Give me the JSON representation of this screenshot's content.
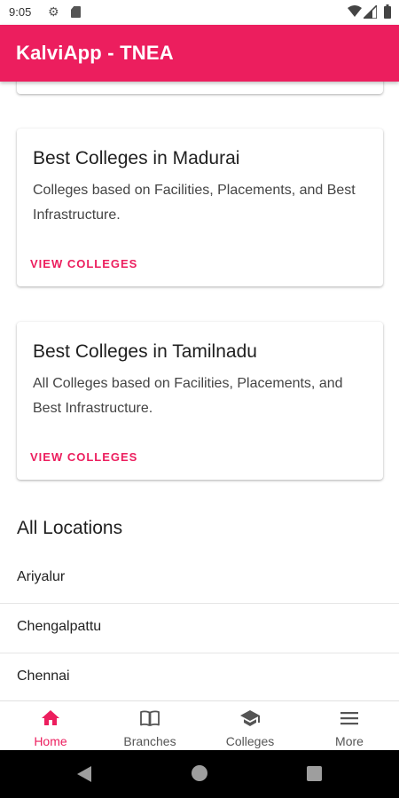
{
  "status_bar": {
    "time": "9:05",
    "icons": [
      "gear-icon",
      "sd-card-icon",
      "wifi-icon",
      "signal-icon",
      "battery-icon"
    ]
  },
  "app_bar": {
    "title": "KalviApp - TNEA",
    "color": "#ec1e5e"
  },
  "cards": [
    {
      "title": "Best Colleges in Madurai",
      "description": "Colleges based on Facilities, Placements, and Best Infrastructure.",
      "action": "VIEW COLLEGES"
    },
    {
      "title": "Best Colleges in Tamilnadu",
      "description": "All Colleges based on Facilities, Placements, and Best Infrastructure.",
      "action": "VIEW COLLEGES"
    }
  ],
  "locations": {
    "title": "All Locations",
    "items": [
      "Ariyalur",
      "Chengalpattu",
      "Chennai"
    ]
  },
  "bottom_nav": {
    "items": [
      {
        "label": "Home",
        "icon": "home-icon",
        "active": true
      },
      {
        "label": "Branches",
        "icon": "book-icon",
        "active": false
      },
      {
        "label": "Colleges",
        "icon": "graduation-cap-icon",
        "active": false
      },
      {
        "label": "More",
        "icon": "menu-icon",
        "active": false
      }
    ]
  },
  "system_nav": {
    "icons": [
      "back-icon",
      "home-circle-icon",
      "recents-icon"
    ]
  },
  "colors": {
    "accent": "#ec1e5e",
    "inactive_nav": "#555555",
    "system_nav_bg": "#000000"
  }
}
